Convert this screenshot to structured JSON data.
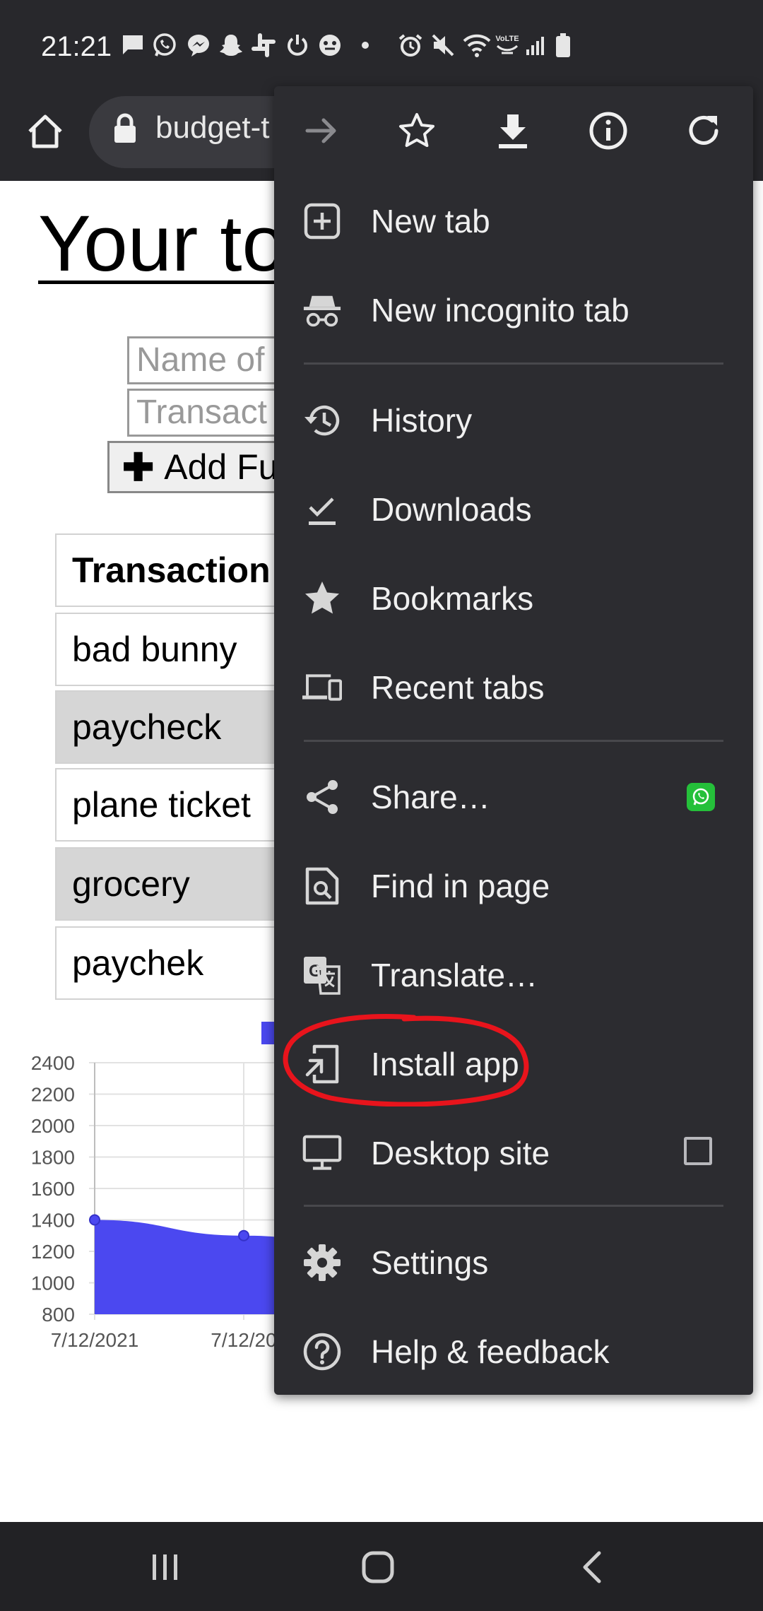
{
  "status_bar": {
    "time": "21:21",
    "volte": "VoLTE"
  },
  "browser": {
    "url": "budget-t"
  },
  "page": {
    "title": "Your to",
    "name_input_placeholder": "Name of",
    "amount_input_placeholder": "Transact",
    "add_funds_label": "Add Fu",
    "table": {
      "header": "Transaction",
      "rows": [
        "bad bunny",
        "paycheck",
        "plane ticket",
        "grocery",
        "paychek"
      ]
    }
  },
  "chart_data": {
    "type": "area",
    "y_ticks": [
      "2400",
      "2200",
      "2000",
      "1800",
      "1600",
      "1400",
      "1200",
      "1000",
      "800"
    ],
    "ylim": [
      800,
      2400
    ],
    "x_ticks": [
      "7/12/2021",
      "7/12/20"
    ],
    "x": [
      "7/12/2021",
      "7/12/20",
      ""
    ],
    "values": [
      1400,
      1300,
      1200
    ],
    "color": "#4b48f0"
  },
  "menu": {
    "items": [
      {
        "key": "new-tab",
        "label": "New tab",
        "icon": "plus-box-icon"
      },
      {
        "key": "new-incognito-tab",
        "label": "New incognito tab",
        "icon": "incognito-icon"
      },
      {
        "key": "history",
        "label": "History",
        "icon": "history-icon"
      },
      {
        "key": "downloads",
        "label": "Downloads",
        "icon": "downloads-check-icon"
      },
      {
        "key": "bookmarks",
        "label": "Bookmarks",
        "icon": "star-icon"
      },
      {
        "key": "recent-tabs",
        "label": "Recent tabs",
        "icon": "devices-icon"
      },
      {
        "key": "share",
        "label": "Share…",
        "icon": "share-icon"
      },
      {
        "key": "find-in-page",
        "label": "Find in page",
        "icon": "find-page-icon"
      },
      {
        "key": "translate",
        "label": "Translate…",
        "icon": "translate-icon"
      },
      {
        "key": "install-app",
        "label": "Install app",
        "icon": "install-app-icon"
      },
      {
        "key": "desktop-site",
        "label": "Desktop site",
        "icon": "monitor-icon"
      },
      {
        "key": "settings",
        "label": "Settings",
        "icon": "gear-icon"
      },
      {
        "key": "help-feedback",
        "label": "Help & feedback",
        "icon": "help-icon"
      }
    ],
    "desktop_site_checked": false,
    "annotation_color": "#e8141c"
  }
}
